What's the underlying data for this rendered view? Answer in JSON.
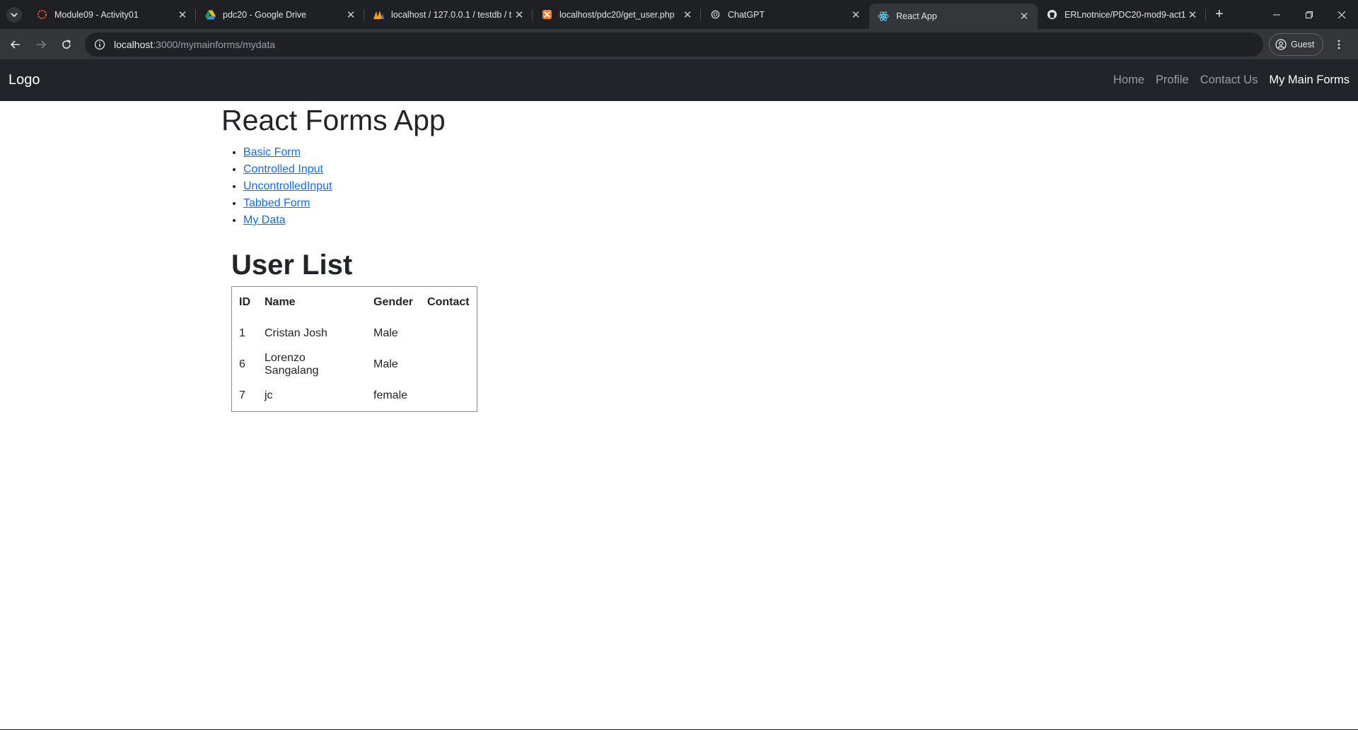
{
  "browser": {
    "tabs": [
      {
        "title": "Module09 - Activity01",
        "favicon": "canvas-icon",
        "color": "#e84b3c"
      },
      {
        "title": "pdc20 - Google Drive",
        "favicon": "google-drive-icon"
      },
      {
        "title": "localhost / 127.0.0.1 / testdb / t",
        "favicon": "phpmyadmin-icon"
      },
      {
        "title": "localhost/pdc20/get_user.php",
        "favicon": "xampp-icon",
        "color": "#fb7a24"
      },
      {
        "title": "ChatGPT",
        "favicon": "chatgpt-icon"
      },
      {
        "title": "React App",
        "favicon": "react-icon",
        "color": "#61dafb",
        "active": true
      },
      {
        "title": "ERLnotnice/PDC20-mod9-act1",
        "favicon": "github-icon"
      }
    ],
    "url_host": "localhost",
    "url_path": ":3000/mymainforms/mydata",
    "profile_label": "Guest"
  },
  "navbar": {
    "brand": "Logo",
    "links": [
      {
        "label": "Home"
      },
      {
        "label": "Profile"
      },
      {
        "label": "Contact Us"
      },
      {
        "label": "My Main Forms",
        "active": true
      }
    ]
  },
  "page": {
    "title": "React Forms App",
    "menu": [
      "Basic Form",
      "Controlled Input",
      "UncontrolledInput",
      "Tabbed Form",
      "My Data"
    ]
  },
  "user_list": {
    "heading": "User List",
    "columns": [
      "ID",
      "Name",
      "Gender",
      "Contact"
    ],
    "rows": [
      {
        "id": "1",
        "name": "Cristan Josh",
        "gender": "Male",
        "contact": ""
      },
      {
        "id": "6",
        "name": "Lorenzo Sangalang",
        "gender": "Male",
        "contact": ""
      },
      {
        "id": "7",
        "name": "jc",
        "gender": "female",
        "contact": ""
      }
    ]
  },
  "colors": {
    "navbar_bg": "#212529",
    "link": "#0d6efd",
    "tabstrip_bg": "#1f2023",
    "toolbar_bg": "#35363a"
  }
}
